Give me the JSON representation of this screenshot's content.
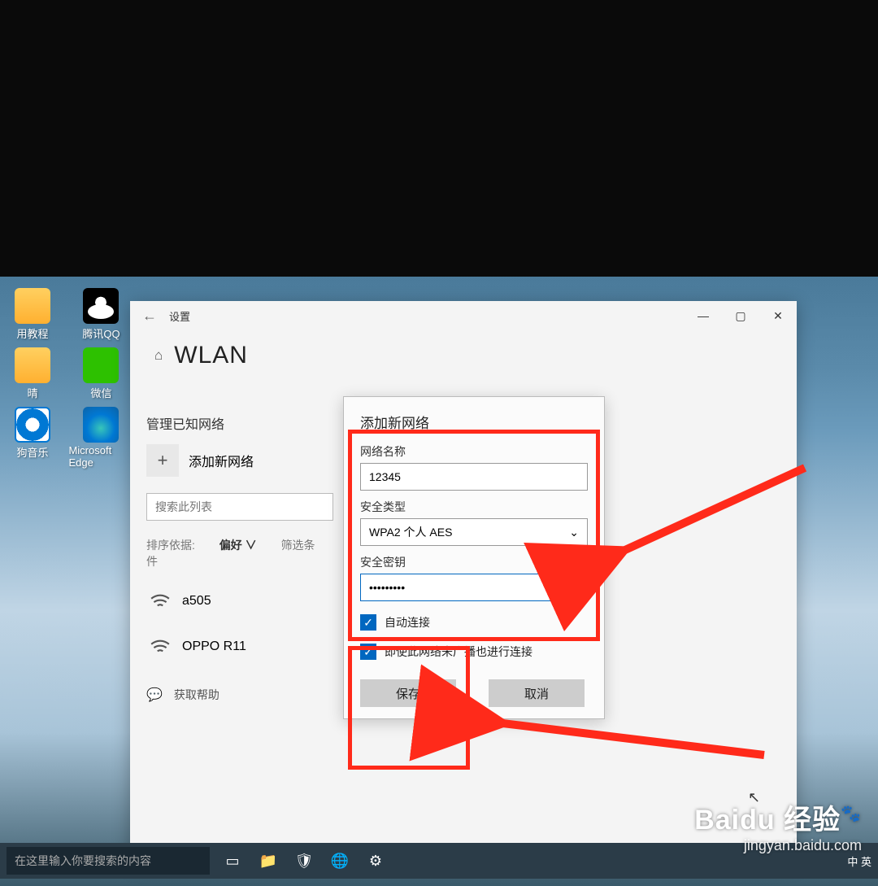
{
  "desktop": {
    "icons": [
      "用教程",
      "腾讯QQ",
      "晴",
      "微信",
      "狗音乐",
      "Microsoft Edge"
    ]
  },
  "window": {
    "title": "设置",
    "page_title": "WLAN",
    "section_title": "管理已知网络",
    "add_network_label": "添加新网络",
    "search_placeholder": "搜索此列表",
    "sort_label": "排序依据:",
    "sort_value": "偏好 ∨",
    "filter_label": "筛选条件",
    "networks": [
      "a505",
      "OPPO R11"
    ],
    "help_label": "获取帮助"
  },
  "dialog": {
    "title": "添加新网络",
    "name_label": "网络名称",
    "name_value": "12345",
    "security_label": "安全类型",
    "security_value": "WPA2 个人 AES",
    "key_label": "安全密钥",
    "key_value": "•••••••••",
    "auto_connect_label": "自动连接",
    "connect_hidden_label": "即使此网络未广播也进行连接",
    "save_button": "保存",
    "cancel_button": "取消"
  },
  "taskbar": {
    "search_placeholder": "在这里输入你要搜索的内容",
    "tray": "中 英"
  },
  "watermark": {
    "logo": "Baidu 经验",
    "url": "jingyan.baidu.com"
  }
}
